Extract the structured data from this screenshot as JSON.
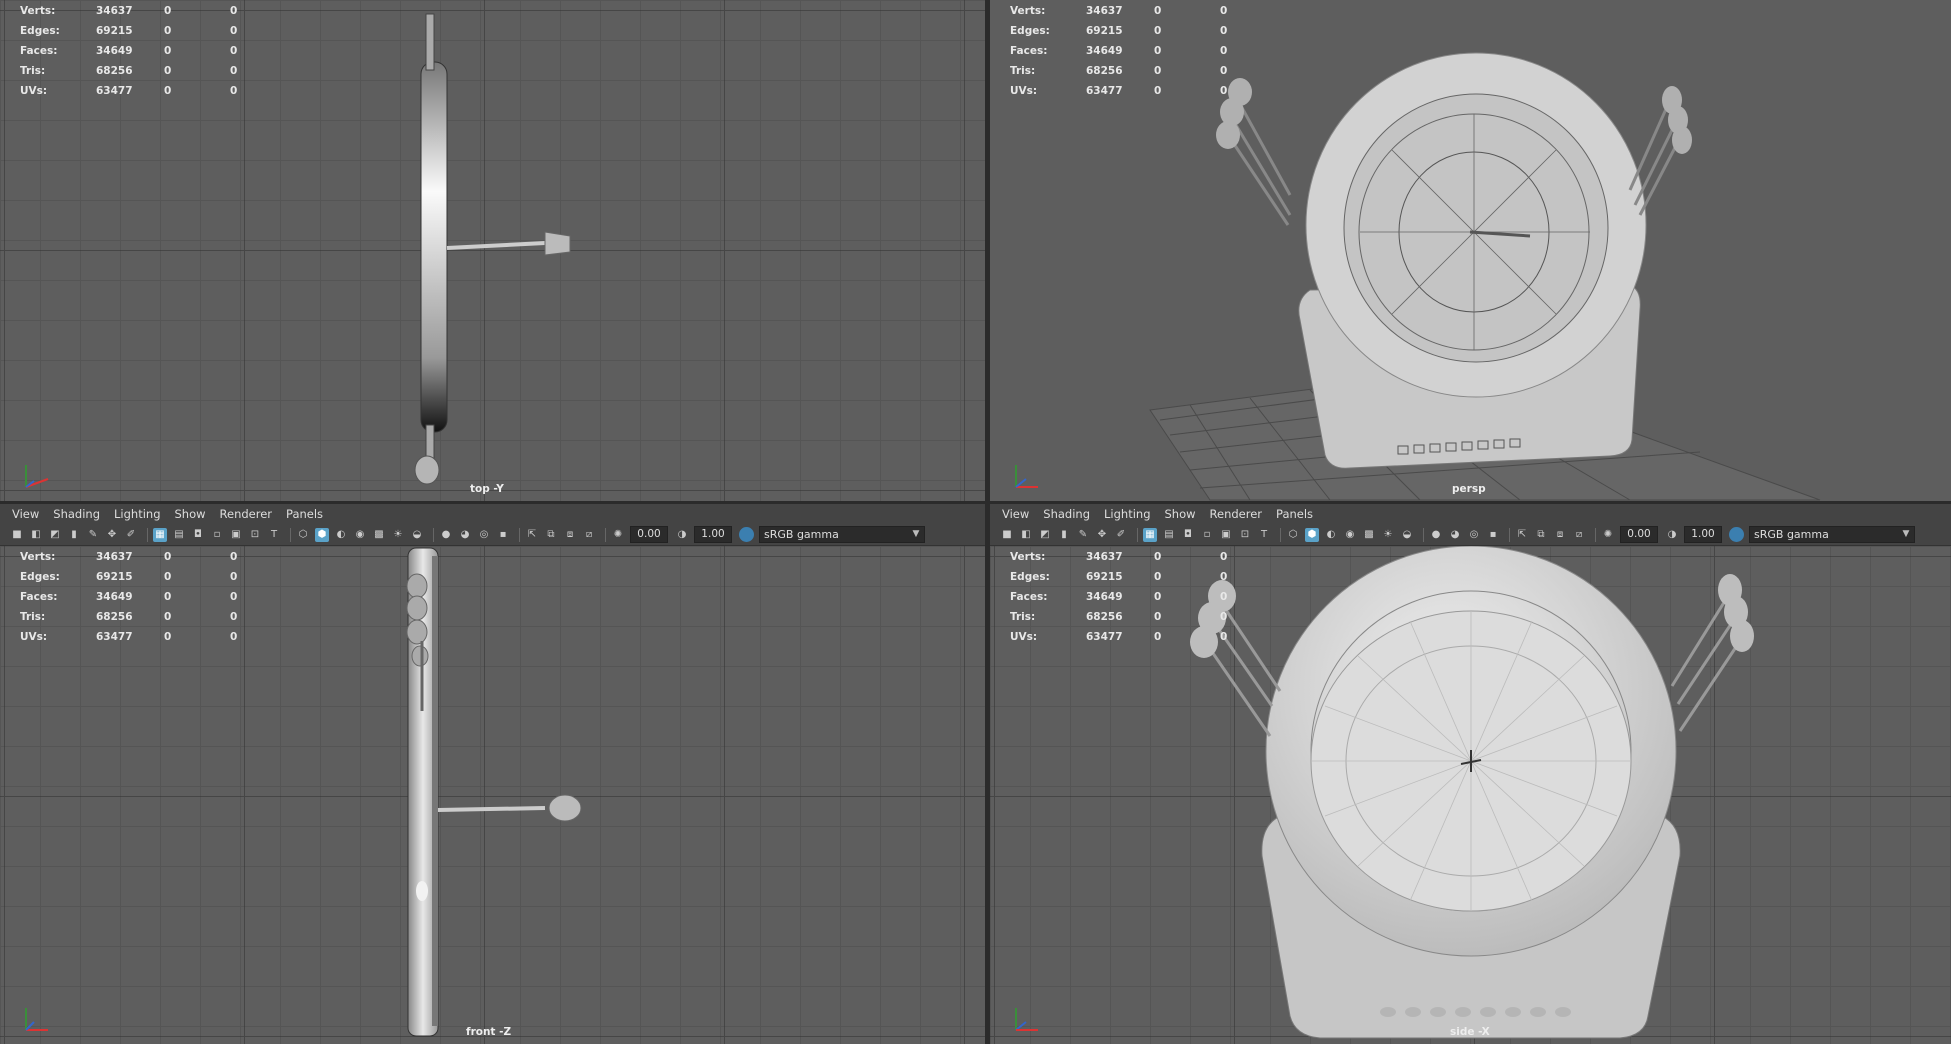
{
  "stats": {
    "rows": [
      {
        "label": "Verts:",
        "v1": "34637",
        "v2": "0",
        "v3": "0"
      },
      {
        "label": "Edges:",
        "v1": "69215",
        "v2": "0",
        "v3": "0"
      },
      {
        "label": "Faces:",
        "v1": "34649",
        "v2": "0",
        "v3": "0"
      },
      {
        "label": "Tris:",
        "v1": "68256",
        "v2": "0",
        "v3": "0"
      },
      {
        "label": "UVs:",
        "v1": "63477",
        "v2": "0",
        "v3": "0"
      }
    ]
  },
  "viewports": {
    "top": {
      "camera": "top -Y"
    },
    "persp": {
      "camera": "persp"
    },
    "front": {
      "camera": "front -Z"
    },
    "side": {
      "camera": "side -X"
    }
  },
  "menu": {
    "items": [
      "View",
      "Shading",
      "Lighting",
      "Show",
      "Renderer",
      "Panels"
    ]
  },
  "toolbar": {
    "exposure": "0.00",
    "gamma": "1.00",
    "color_space": "sRGB gamma"
  },
  "colors": {
    "viewport_bg": "#5e5e5e",
    "panel_bg": "#444444",
    "highlight": "#5aa2c8"
  }
}
